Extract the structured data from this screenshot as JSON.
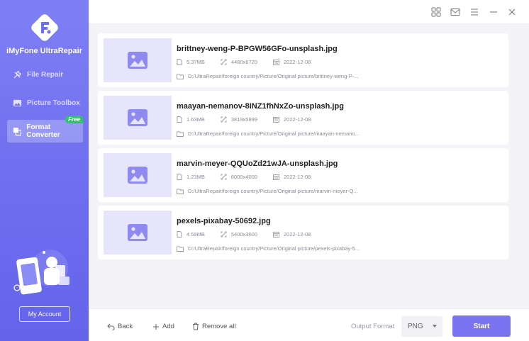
{
  "app": {
    "name": "iMyFone UltraRepair"
  },
  "sidebar": {
    "items": [
      {
        "label": "File Repair",
        "icon": "wrench-icon"
      },
      {
        "label": "Picture Toolbox",
        "icon": "image-icon"
      },
      {
        "label": "Format Converter",
        "icon": "convert-icon",
        "badge": "Free"
      }
    ],
    "account_label": "My Account"
  },
  "files": [
    {
      "name": "brittney-weng-P-BPGW56GFo-unsplash.jpg",
      "size": "5.37MB",
      "resolution": "4480x6720",
      "date": "2022-12-08",
      "path": "D:/UltraRepair/foreign country/Picture/Original picture/brittney-weng-P-..."
    },
    {
      "name": "maayan-nemanov-8INZ1fhNxZo-unsplash.jpg",
      "size": "1.63MB",
      "resolution": "3819x5899",
      "date": "2022-12-08",
      "path": "D:/UltraRepair/foreign country/Picture/Original picture/maayan-nemano..."
    },
    {
      "name": "marvin-meyer-QQUoZd21wJA-unsplash.jpg",
      "size": "1.23MB",
      "resolution": "6000x4000",
      "date": "2022-12-08",
      "path": "D:/UltraRepair/foreign country/Picture/Original picture/marvin-meyer-Q..."
    },
    {
      "name": "pexels-pixabay-50692.jpg",
      "size": "4.59MB",
      "resolution": "5400x3600",
      "date": "2022-12-08",
      "path": "D:/UltraRepair/foreign country/Picture/Original picture/pexels-pixabay-5..."
    }
  ],
  "bottom": {
    "back_label": "Back",
    "add_label": "Add",
    "remove_label": "Remove all",
    "output_label": "Output Format",
    "format_value": "PNG",
    "start_label": "Start"
  },
  "colors": {
    "accent": "#7a74f2",
    "sidebar": "#6e6ef0",
    "badge": "#2ec46b"
  }
}
